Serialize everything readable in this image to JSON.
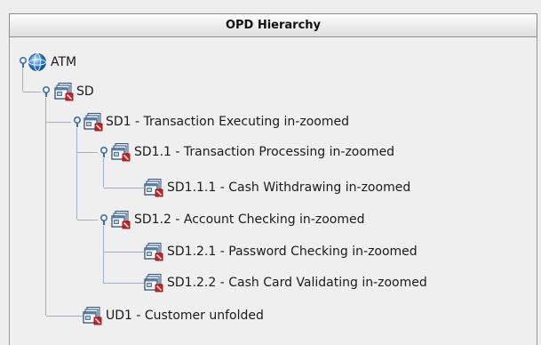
{
  "header": {
    "title": "OPD Hierarchy"
  },
  "colors": {
    "guide_line": "#9fb1c9",
    "handle": "#3a6ea5",
    "badge": "#d62020",
    "globe": "#2f7fd6"
  },
  "tree": {
    "nodes": [
      {
        "id": "atm",
        "label": "ATM",
        "icon": "globe-icon",
        "expanded": true
      },
      {
        "id": "sd",
        "label": "SD",
        "icon": "diagram-icon",
        "expanded": true
      },
      {
        "id": "sd1",
        "label": "SD1 - Transaction Executing in-zoomed",
        "icon": "diagram-icon",
        "expanded": true
      },
      {
        "id": "sd1_1",
        "label": "SD1.1 - Transaction Processing in-zoomed",
        "icon": "diagram-icon",
        "expanded": true
      },
      {
        "id": "sd1_1_1",
        "label": "SD1.1.1 - Cash Withdrawing in-zoomed",
        "icon": "diagram-icon",
        "expanded": false
      },
      {
        "id": "sd1_2",
        "label": "SD1.2 - Account Checking in-zoomed",
        "icon": "diagram-icon",
        "expanded": true
      },
      {
        "id": "sd1_2_1",
        "label": "SD1.2.1 - Password Checking in-zoomed",
        "icon": "diagram-icon",
        "expanded": false
      },
      {
        "id": "sd1_2_2",
        "label": "SD1.2.2 - Cash Card Validating in-zoomed",
        "icon": "diagram-icon",
        "expanded": false
      },
      {
        "id": "ud1",
        "label": "UD1 - Customer unfolded",
        "icon": "diagram-icon",
        "expanded": false
      }
    ]
  }
}
